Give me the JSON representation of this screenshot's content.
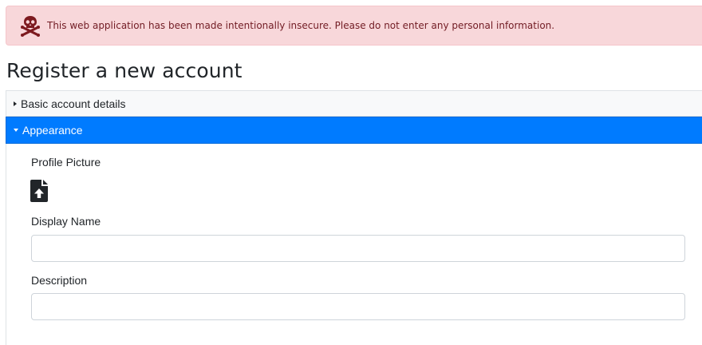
{
  "banner": {
    "icon": "skull-crossbones-icon",
    "message": "This web application has been made intentionally insecure. Please do not enter any personal information."
  },
  "page": {
    "title": "Register a new account"
  },
  "sections": {
    "basic": {
      "label": "Basic account details",
      "expanded": false
    },
    "appearance": {
      "label": "Appearance",
      "expanded": true,
      "profile_picture_label": "Profile Picture",
      "upload_icon": "file-upload-icon",
      "display_name_label": "Display Name",
      "display_name_value": "",
      "description_label": "Description",
      "description_value": ""
    }
  },
  "colors": {
    "banner_bg": "#f8d7da",
    "banner_text": "#721c24",
    "accent": "#007bff"
  }
}
